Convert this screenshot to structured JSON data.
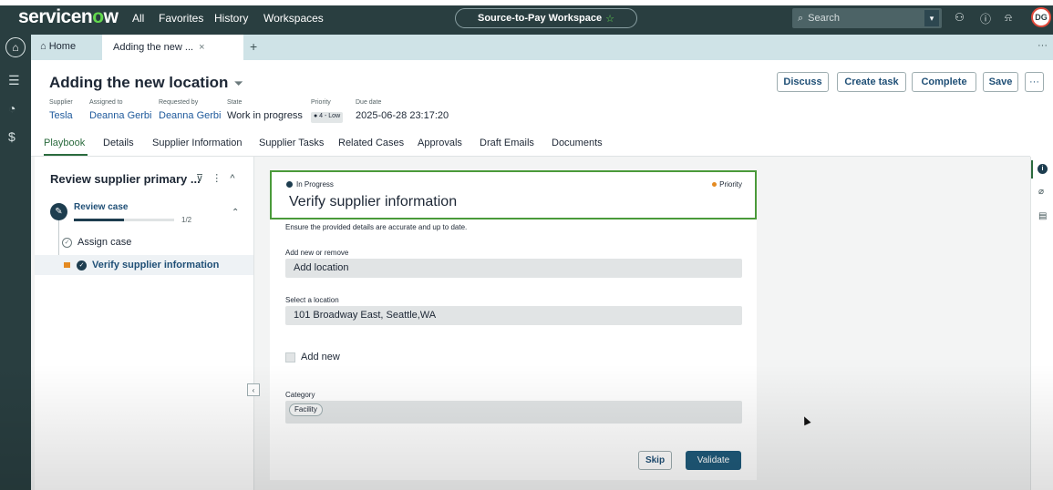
{
  "topbar": {
    "logo_prefix": "servicen",
    "logo_o": "o",
    "logo_suffix": "w",
    "nav": [
      "All",
      "Favorites",
      "History",
      "Workspaces"
    ],
    "workspace_label": "Source-to-Pay Workspace",
    "workspace_star": "☆",
    "search_placeholder": "Search",
    "avatar_initials": "DG"
  },
  "tabs": {
    "home_label": "Home",
    "active_label": "Adding the new ...",
    "close": "×",
    "add": "+",
    "more": "···"
  },
  "record": {
    "title": "Adding the new location",
    "fields": {
      "supplier_label": "Supplier",
      "supplier_value": "Tesla",
      "assigned_label": "Assigned to",
      "assigned_value": "Deanna Gerbi",
      "requested_label": "Requested by",
      "requested_value": "Deanna Gerbi",
      "state_label": "State",
      "state_value": "Work in progress",
      "priority_label": "Priority",
      "priority_value": "● 4 - Low",
      "due_label": "Due date",
      "due_value": "2025-06-28 23:17:20"
    },
    "buttons": {
      "discuss": "Discuss",
      "create_task": "Create task",
      "complete": "Complete",
      "save": "Save",
      "more": "···"
    },
    "tabs": [
      "Playbook",
      "Details",
      "Supplier Information",
      "Supplier Tasks",
      "Related Cases",
      "Approvals",
      "Draft Emails",
      "Documents"
    ]
  },
  "playbook": {
    "title": "Review supplier primary ...",
    "stage_label": "Review case",
    "stage_progress": 0.5,
    "stage_count": "1/2",
    "tasks": [
      "Assign case",
      "Verify supplier information"
    ]
  },
  "card": {
    "status": "In Progress",
    "priority": "Priority",
    "title": "Verify supplier information",
    "description": "Ensure the provided details are accurate and up to date.",
    "add_remove_label": "Add new or remove",
    "add_remove_value": "Add location",
    "location_label": "Select a location",
    "location_value": "101 Broadway East, Seattle,WA",
    "add_new_label": "Add new",
    "category_label": "Category",
    "category_chip": "Facility",
    "skip": "Skip",
    "validate": "Validate"
  },
  "colors": {
    "nav_bg": "#293e40",
    "tab_strip": "#cfe3e7",
    "accent_green": "#4a9a3a",
    "primary_btn": "#1f5a7a",
    "priority_dot": "#e48a21"
  }
}
